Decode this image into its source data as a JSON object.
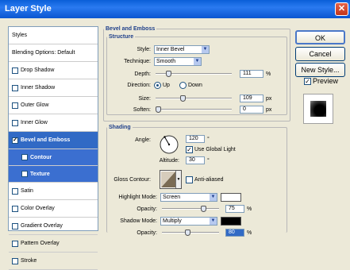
{
  "window": {
    "title": "Layer Style",
    "close_glyph": "✕"
  },
  "sidebar": {
    "items": [
      {
        "label": "Styles",
        "checkbox": false
      },
      {
        "label": "Blending Options: Default",
        "checkbox": false
      },
      {
        "label": "Drop Shadow",
        "checkbox": true,
        "checked": false
      },
      {
        "label": "Inner Shadow",
        "checkbox": true,
        "checked": false
      },
      {
        "label": "Outer Glow",
        "checkbox": true,
        "checked": false
      },
      {
        "label": "Inner Glow",
        "checkbox": true,
        "checked": false
      },
      {
        "label": "Bevel and Emboss",
        "checkbox": true,
        "checked": true,
        "selected": true
      },
      {
        "label": "Contour",
        "checkbox": true,
        "checked": false,
        "sub": true
      },
      {
        "label": "Texture",
        "checkbox": true,
        "checked": false,
        "sub": true
      },
      {
        "label": "Satin",
        "checkbox": true,
        "checked": false
      },
      {
        "label": "Color Overlay",
        "checkbox": true,
        "checked": false
      },
      {
        "label": "Gradient Overlay",
        "checkbox": true,
        "checked": false
      },
      {
        "label": "Pattern Overlay",
        "checkbox": true,
        "checked": false
      },
      {
        "label": "Stroke",
        "checkbox": true,
        "checked": false
      }
    ]
  },
  "bevel": {
    "group_title": "Bevel and Emboss",
    "structure_title": "Structure",
    "style_label": "Style:",
    "style_value": "Inner Bevel",
    "technique_label": "Technique:",
    "technique_value": "Smooth",
    "depth_label": "Depth:",
    "depth_value": "111",
    "depth_unit": "%",
    "depth_level": 0.15,
    "direction_label": "Direction:",
    "dir_up": "Up",
    "dir_down": "Down",
    "size_label": "Size:",
    "size_value": "109",
    "size_unit": "px",
    "size_level": 0.35,
    "soften_label": "Soften:",
    "soften_value": "0",
    "soften_unit": "px",
    "soften_level": 0.0
  },
  "shading": {
    "title": "Shading",
    "angle_label": "Angle:",
    "angle_value": "120",
    "angle_unit": "°",
    "global_light_label": "Use Global Light",
    "altitude_label": "Altitude:",
    "altitude_value": "30",
    "altitude_unit": "°",
    "gloss_label": "Gloss Contour:",
    "anti_alias_label": "Anti-aliased",
    "highlight_label": "Highlight Mode:",
    "highlight_mode": "Screen",
    "highlight_color": "#ffffff",
    "h_opacity_label": "Opacity:",
    "h_opacity_value": "75",
    "h_opacity_unit": "%",
    "h_opacity_level": 0.75,
    "shadow_label": "Shadow Mode:",
    "shadow_mode": "Multiply",
    "shadow_color": "#000000",
    "s_opacity_label": "Opacity:",
    "s_opacity_value": "80",
    "s_opacity_unit": "%",
    "s_opacity_level": 0.45
  },
  "buttons": {
    "ok": "OK",
    "cancel": "Cancel",
    "new_style": "New Style...",
    "preview": "Preview"
  }
}
